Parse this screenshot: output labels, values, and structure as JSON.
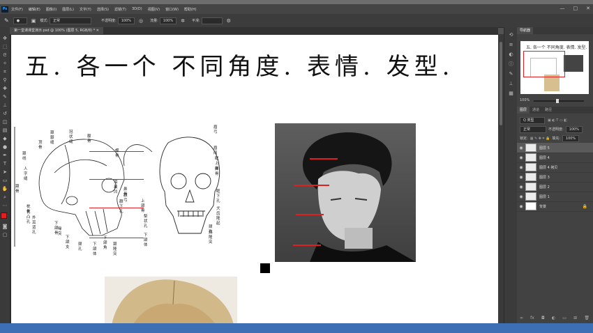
{
  "app": {
    "logo": "Ps",
    "menu": [
      "文件(F)",
      "编辑(E)",
      "图像(I)",
      "图层(L)",
      "文字(Y)",
      "选择(S)",
      "滤镜(T)",
      "3D(D)",
      "视图(V)",
      "窗口(W)",
      "帮助(H)"
    ],
    "window_buttons": [
      "—",
      "□",
      "✕"
    ]
  },
  "options_bar": {
    "mode_label": "模式:",
    "mode_value": "正常",
    "opacity_label": "不透明度:",
    "opacity_value": "100%",
    "flow_label": "流量:",
    "flow_value": "100%",
    "smooth_label": "平滑:"
  },
  "document": {
    "tab_title": "第一堂课课堂演示.psd @ 100% (图层 5, RGB/8) *"
  },
  "canvas": {
    "heading": "五. 各一个 不同角度. 表情. 发型.",
    "skull_labels_left": [
      "颞颥缝",
      "冠状缝",
      "顶骨",
      "额骨",
      "蝶骨",
      "颞线",
      "人字缝",
      "颞骨",
      "泪囊凹",
      "鼻骨",
      "颧弓",
      "颧下孔",
      "枕骨",
      "乳凸孔",
      "外耳道孔",
      "下颌骨",
      "喙突",
      "下颌支",
      "颏孔",
      "下颌体",
      "下颌角",
      "颞隆突"
    ],
    "skull_labels_right": [
      "眉弓",
      "眉间",
      "眶上缘",
      "鼻骨",
      "眶下孔",
      "犬齿隆起",
      "上颌骨",
      "梨状孔",
      "下颌体",
      "颏孔",
      "颏隆突"
    ],
    "chart_marks": "red guide lines"
  },
  "navigator": {
    "tab_label": "导航器",
    "zoom": "100%"
  },
  "layers_panel": {
    "tabs": [
      "图层",
      "通道",
      "路径"
    ],
    "kind_label": "Q 类型",
    "blend_mode": "正常",
    "opacity_label": "不透明度:",
    "opacity_value": "100%",
    "lock_label": "锁定:",
    "fill_label": "填充:",
    "fill_value": "100%",
    "layers": [
      {
        "name": "图层 5",
        "selected": true
      },
      {
        "name": "图层 4",
        "selected": false
      },
      {
        "name": "图层 4 拷贝",
        "selected": false
      },
      {
        "name": "图层 3",
        "selected": false
      },
      {
        "name": "图层 2",
        "selected": false
      },
      {
        "name": "图层 1",
        "selected": false
      },
      {
        "name": "背景",
        "selected": false
      }
    ]
  },
  "colors": {
    "accent": "#3c6fb3",
    "guide_red": "#e02020",
    "foreground": "#e02020",
    "background": "#ffffff"
  }
}
